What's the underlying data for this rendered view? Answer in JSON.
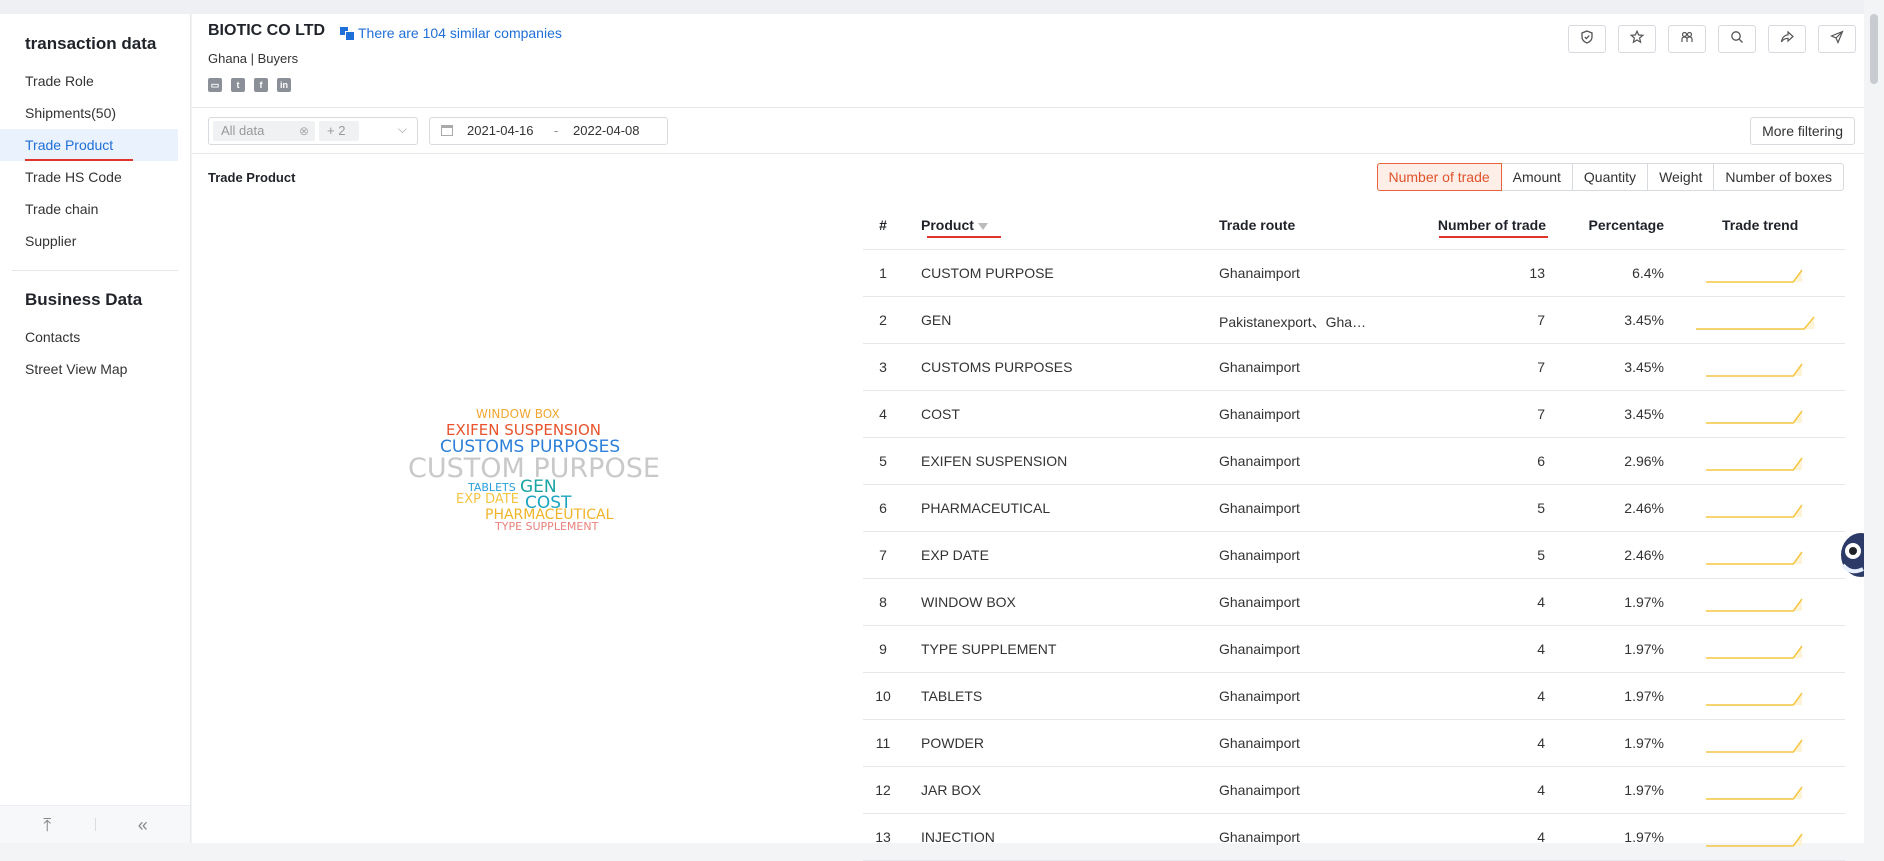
{
  "sidebar": {
    "section1_title": "transaction data",
    "items1": [
      {
        "label": "Trade Role"
      },
      {
        "label": "Shipments(50)"
      },
      {
        "label": "Trade Product"
      },
      {
        "label": "Trade HS Code"
      },
      {
        "label": "Trade chain"
      },
      {
        "label": "Supplier"
      }
    ],
    "section2_title": "Business Data",
    "items2": [
      {
        "label": "Contacts"
      },
      {
        "label": "Street View Map"
      }
    ],
    "footer": {
      "top_icon": "⤒",
      "collapse_icon": "«"
    }
  },
  "header": {
    "company": "BIOTIC CO LTD",
    "similar": "There are 104 similar companies",
    "location": "Ghana | Buyers",
    "socials": [
      "fax-icon",
      "twitter-icon",
      "facebook-icon",
      "linkedin-icon"
    ],
    "actions": [
      "shield-icon",
      "star-icon",
      "people-icon",
      "search-icon",
      "share-icon",
      "send-icon"
    ]
  },
  "filters": {
    "chip1": "All data",
    "chip2": "+ 2",
    "date_start": "2021-04-16",
    "date_sep": "-",
    "date_end": "2022-04-08",
    "more": "More filtering"
  },
  "section": {
    "title": "Trade Product",
    "tabs": [
      "Number of trade",
      "Amount",
      "Quantity",
      "Weight",
      "Number of boxes"
    ],
    "active_tab": "Number of trade"
  },
  "wordcloud": [
    {
      "text": "WINDOW BOX",
      "color": "#f0a830"
    },
    {
      "text": "EXIFEN SUSPENSION",
      "color": "#e8532b"
    },
    {
      "text": "CUSTOMS PURPOSES",
      "color": "#2b7fd8"
    },
    {
      "text": "CUSTOM PURPOSE",
      "color": "#c9c9c9"
    },
    {
      "text": "TABLETS",
      "color": "#2b9fd8"
    },
    {
      "text": "GEN",
      "color": "#1aa3a3"
    },
    {
      "text": "EXP DATE",
      "color": "#f5c542"
    },
    {
      "text": "COST",
      "color": "#1aa3c0"
    },
    {
      "text": "PHARMACEUTICAL",
      "color": "#f0b429"
    },
    {
      "text": "TYPE SUPPLEMENT",
      "color": "#e8827a"
    }
  ],
  "table": {
    "headers": {
      "idx": "#",
      "product": "Product",
      "route": "Trade route",
      "num": "Number of trade",
      "pct": "Percentage",
      "trend": "Trade trend"
    },
    "rows": [
      {
        "idx": "1",
        "product": "CUSTOM PURPOSE",
        "route": "Ghanaimport",
        "num": "13",
        "pct": "6.4%",
        "trend": [
          0,
          0,
          0,
          0,
          0,
          0,
          0,
          0,
          0,
          0,
          0,
          1
        ]
      },
      {
        "idx": "2",
        "product": "GEN",
        "route": "Pakistanexport、Gha…",
        "num": "7",
        "pct": "3.45%",
        "trend": [
          0,
          0,
          0,
          0,
          0,
          0,
          0,
          0,
          0,
          0,
          0,
          0,
          1
        ]
      },
      {
        "idx": "3",
        "product": "CUSTOMS PURPOSES",
        "route": "Ghanaimport",
        "num": "7",
        "pct": "3.45%",
        "trend": [
          0,
          0,
          0,
          0,
          0,
          0,
          0,
          0,
          0,
          0,
          0,
          1
        ]
      },
      {
        "idx": "4",
        "product": "COST",
        "route": "Ghanaimport",
        "num": "7",
        "pct": "3.45%",
        "trend": [
          0,
          0,
          0,
          0,
          0,
          0,
          0,
          0,
          0,
          0,
          0,
          1
        ]
      },
      {
        "idx": "5",
        "product": "EXIFEN SUSPENSION",
        "route": "Ghanaimport",
        "num": "6",
        "pct": "2.96%",
        "trend": [
          0,
          0,
          0,
          0,
          0,
          0,
          0,
          0,
          0,
          0,
          0,
          1
        ]
      },
      {
        "idx": "6",
        "product": "PHARMACEUTICAL",
        "route": "Ghanaimport",
        "num": "5",
        "pct": "2.46%",
        "trend": [
          0,
          0,
          0,
          0,
          0,
          0,
          0,
          0,
          0,
          0,
          0,
          1
        ]
      },
      {
        "idx": "7",
        "product": "EXP DATE",
        "route": "Ghanaimport",
        "num": "5",
        "pct": "2.46%",
        "trend": [
          0,
          0,
          0,
          0,
          0,
          0,
          0,
          0,
          0,
          0,
          0,
          1
        ]
      },
      {
        "idx": "8",
        "product": "WINDOW BOX",
        "route": "Ghanaimport",
        "num": "4",
        "pct": "1.97%",
        "trend": [
          0,
          0,
          0,
          0,
          0,
          0,
          0,
          0,
          0,
          0,
          0,
          1
        ]
      },
      {
        "idx": "9",
        "product": "TYPE SUPPLEMENT",
        "route": "Ghanaimport",
        "num": "4",
        "pct": "1.97%",
        "trend": [
          0,
          0,
          0,
          0,
          0,
          0,
          0,
          0,
          0,
          0,
          0,
          1
        ]
      },
      {
        "idx": "10",
        "product": "TABLETS",
        "route": "Ghanaimport",
        "num": "4",
        "pct": "1.97%",
        "trend": [
          0,
          0,
          0,
          0,
          0,
          0,
          0,
          0,
          0,
          0,
          0,
          1
        ]
      },
      {
        "idx": "11",
        "product": "POWDER",
        "route": "Ghanaimport",
        "num": "4",
        "pct": "1.97%",
        "trend": [
          0,
          0,
          0,
          0,
          0,
          0,
          0,
          0,
          0,
          0,
          0,
          1
        ]
      },
      {
        "idx": "12",
        "product": "JAR BOX",
        "route": "Ghanaimport",
        "num": "4",
        "pct": "1.97%",
        "trend": [
          0,
          0,
          0,
          0,
          0,
          0,
          0,
          0,
          0,
          0,
          0,
          1
        ]
      },
      {
        "idx": "13",
        "product": "INJECTION",
        "route": "Ghanaimport",
        "num": "4",
        "pct": "1.97%",
        "trend": [
          0,
          0,
          0,
          0,
          0,
          0,
          0,
          0,
          0,
          0,
          0,
          1
        ]
      }
    ]
  },
  "colors": {
    "accent": "#e0352b",
    "link": "#1f6fd8",
    "trend": "#f5c542"
  }
}
